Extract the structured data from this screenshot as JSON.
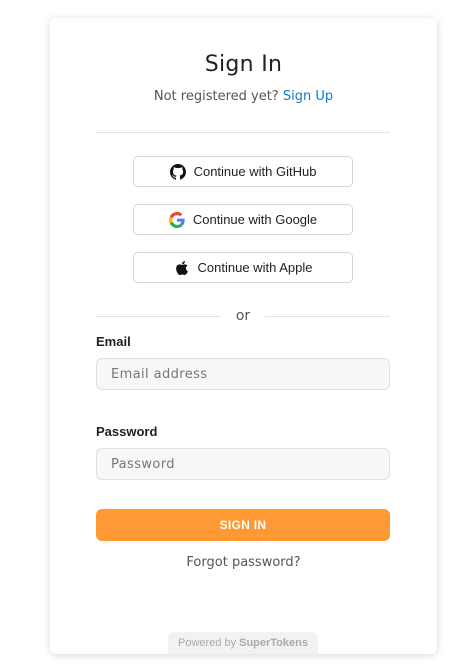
{
  "signin": {
    "title": "Sign In",
    "subtitle_text": "Not registered yet?",
    "signup_link": "Sign Up",
    "providers": [
      {
        "label": "Continue with GitHub",
        "icon": "github-icon"
      },
      {
        "label": "Continue with Google",
        "icon": "google-icon"
      },
      {
        "label": "Continue with Apple",
        "icon": "apple-icon"
      }
    ],
    "or_text": "or",
    "email": {
      "label": "Email",
      "placeholder": "Email address",
      "value": ""
    },
    "password": {
      "label": "Password",
      "placeholder": "Password",
      "value": ""
    },
    "submit_label": "SIGN IN",
    "forgot_link": "Forgot password?"
  },
  "footer": {
    "powered_prefix": "Powered by",
    "brand": "SuperTokens"
  },
  "colors": {
    "accent": "#ff9933",
    "link": "#0f7acc"
  }
}
